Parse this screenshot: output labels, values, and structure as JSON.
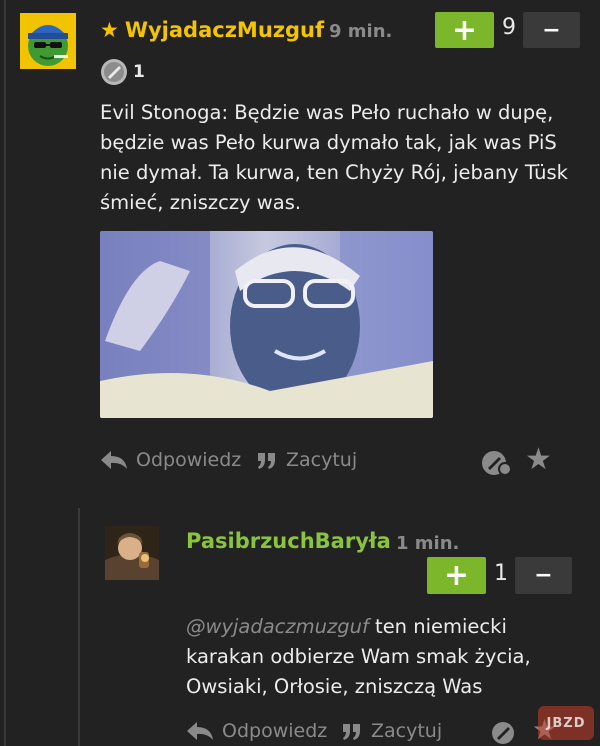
{
  "comment": {
    "author": "WyjadaczMuzguf",
    "author_prefix_icon": "star-icon",
    "time": "9 min.",
    "score": "9",
    "plus_label": "+",
    "minus_label": "−",
    "badge_count": "1",
    "text": "Evil Stonoga: Będzie was Pełο ruchało w dupę, będzie was Pełο kurwa dymało tak, jak was PiS nie dymał. Ta kurwa, ten Chyży Rój, jebany Tüsk śmieć, zniszczy was.",
    "actions": {
      "reply": "Odpowiedz",
      "quote": "Zacytuj"
    },
    "colors": {
      "author": "#f5c400",
      "plus": "#7cb72b"
    }
  },
  "reply": {
    "author": "PasibrzuchBaryła",
    "time": "1 min.",
    "score": "1",
    "plus_label": "+",
    "minus_label": "−",
    "mention": "@wyjadaczmuzguf",
    "text": " ten niemiecki karakan odbierze Wam smak życia, Owsiaki, Orłosie, zniszczą Was",
    "actions": {
      "reply": "Odpowiedz",
      "quote": "Zacytuj"
    },
    "colors": {
      "author": "#8ac43f"
    }
  },
  "watermark": "JBZD"
}
